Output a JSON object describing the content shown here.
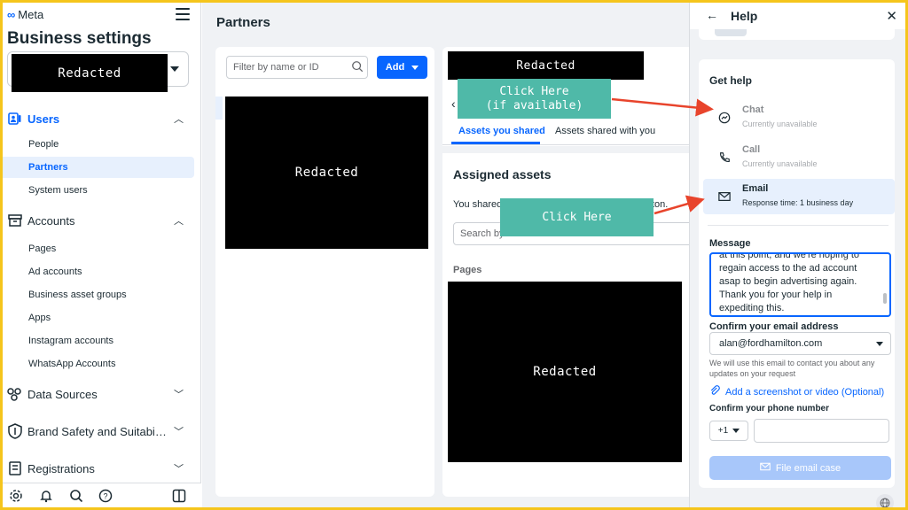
{
  "brand": {
    "logo_text": "Meta"
  },
  "sidebar": {
    "title": "Business settings",
    "account_redacted": "Redacted",
    "sections": [
      {
        "label": "Users",
        "icon": "users-icon",
        "chevron": "up"
      },
      {
        "label": "Accounts",
        "icon": "accounts-icon",
        "chevron": "up"
      },
      {
        "label": "Data Sources",
        "icon": "data-sources-icon",
        "chevron": "down"
      },
      {
        "label": "Brand Safety and Suitabi…",
        "icon": "shield-icon",
        "chevron": "down"
      },
      {
        "label": "Registrations",
        "icon": "registrations-icon",
        "chevron": "down"
      }
    ],
    "users_items": [
      "People",
      "Partners",
      "System users"
    ],
    "accounts_items": [
      "Pages",
      "Ad accounts",
      "Business asset groups",
      "Apps",
      "Instagram accounts",
      "WhatsApp Accounts"
    ],
    "selected_item": "Partners"
  },
  "main": {
    "title": "Partners",
    "filter_placeholder": "Filter by name or ID",
    "add_label": "Add",
    "left_redacted": "Redacted",
    "detail": {
      "name_redacted": "Redacted",
      "tabs": [
        "Assets you shared",
        "Assets shared with you"
      ],
      "assigned_title": "Assigned assets",
      "shared_text_start": "You shared",
      "shared_text_end": "ton.",
      "search_placeholder": "Search by",
      "pages_label": "Pages",
      "pages_redacted": "Redacted"
    }
  },
  "help": {
    "title": "Help",
    "get_help_title": "Get help",
    "options": [
      {
        "name": "Chat",
        "status": "Currently unavailable",
        "icon": "messenger-icon"
      },
      {
        "name": "Call",
        "status": "Currently unavailable",
        "icon": "phone-icon"
      },
      {
        "name": "Email",
        "status": "Response time: 1 business day",
        "icon": "envelope-icon"
      }
    ],
    "message_label": "Message",
    "message_text": "at this point, and we're hoping to\nregain access to the ad account\nasap to begin advertising again.\nThank you for your help in\nexpediting this.",
    "email_label": "Confirm your email address",
    "email_value": "alan@fordhamilton.com",
    "email_help": "We will use this email to contact you about any updates on your request",
    "attach_label": "Add a screenshot or video (Optional)",
    "phone_label": "Confirm your phone number",
    "phone_code": "+1",
    "submit_label": "File email case"
  },
  "annotations": {
    "callout_chat_line1": "Click Here",
    "callout_chat_line2": "(if available)",
    "callout_email": "Click Here",
    "callout_color": "#4fb9a8",
    "arrow_color": "#e8442c",
    "frame_color": "#f5c51c"
  }
}
